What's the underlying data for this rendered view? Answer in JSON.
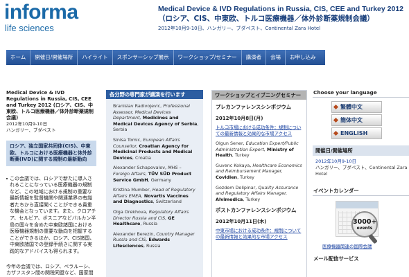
{
  "header": {
    "logo_main": "informa",
    "logo_sub": "life sciences",
    "title_en": "Medical Device & IVD Regulations in Russia, CIS, CEE and Turkey 2012",
    "title_jp": "（ロシア、CIS、中東欧、トルコ医療機器／体外診断薬規制会議）",
    "date_venue": "2012年10月9-10日、ハンガリー、ブダペスト、Continental Zara Hotel"
  },
  "nav": {
    "items": [
      "ホーム",
      "開催日/開催場所",
      "ハイライト",
      "スポンサーシップ展示",
      "ワークショップ/セミナー",
      "講演者",
      "会場",
      "お申し込み"
    ]
  },
  "left": {
    "title": "Medical Device & IVD Regulations in Russia, CIS, CEE and Turkey 2012 (ロシア、CIS、中東欧、トルコ医療機器／体外診断薬規制会議)",
    "date": "2012年10月9-10日",
    "place": "ハンガリー、ブダペスト",
    "highlight": "ロシア、独立国家共同体(CIS)、中東欧、トルコにおける医療機器と体外診断薬(IVD)に関する規制の最新動向",
    "para1": "この会議では、ロシアで新たに導入されることになっている医療機器の規制など、この地域における規制の重要な最新情報を監督機関や関連業界の有識者たちから直接聞くことができる貴重な機会となっています。また、クロアチア、セルビア、ボスニアなどバルカン半島の国々を含めた中東欧諸国における医療機器規制の重要な動向を把握することができるほか、ロシア、CIS諸国、中東欧諸国での登録手続きに関する実践的なアドバイスも得られます。",
    "para2": "今年の会議では、ロシア、ベラルーシ、カザフスタン間の関税同盟など、国家間の協調に向けた動きについての重"
  },
  "speakers": {
    "header": "各分野の専門家が講演を行います",
    "items": [
      {
        "name": "Branislav Radivojevic,",
        "role": "Professional Assessor, Medical Devices Department,",
        "org": "Medicines and Medical Devices Agency of Serbia",
        "country": ", Serbia"
      },
      {
        "name": "Sinisa Tomic,",
        "role": "European Affairs Counsellor,",
        "org": "Croatian Agency for Medicinal Products and Medical Devices",
        "country": ", Croatia"
      },
      {
        "name": "Alexander Schapovalov,",
        "role": "MHS – Foreign Affairs,",
        "org": "TÜV SÜD Product Service GmbH",
        "country": ", Germany"
      },
      {
        "name": "Kristina Mumber,",
        "role": "Head of Regulatory Affairs EMEA,",
        "org": "Novartis Vaccines and Diagnostics",
        "country": ", Switzerland"
      },
      {
        "name": "Olga Orekhova,",
        "role": "Regulatory Affairs Director Russia and CIS,",
        "org": "GE Healthcare",
        "country": ", Russia"
      },
      {
        "name": "Alexander Berezin,",
        "role": "Country Manager Russia and CIS,",
        "org": "Edwards Lifesciences",
        "country": ", Russia"
      }
    ]
  },
  "workshop": {
    "header": "ワークショップとイブニングセミナー",
    "pre_title": "プレカンファレンスシンポジウム",
    "pre_date": "2012年10月8日(月)",
    "pre_link": "トルコ市場における成功条件：規制についての最新情報と効果的な市場アクセス",
    "speakers": [
      {
        "name": "Olgun Sener,",
        "role": "Education Expert/Public Administration Expert,",
        "org": "Ministry of Health",
        "country": ", Turkey"
      },
      {
        "name": "Guvenc Kokaya,",
        "role": "Healthcare Economics and Reimbursement Manager,",
        "org": "Covidien",
        "country": ", Turkey"
      },
      {
        "name": "Gozdem Delipinar,",
        "role": "Quality Assurance and Regulatory Affairs Manager,",
        "org": "Alvimedica",
        "country": ", Turkey"
      }
    ],
    "post_title": "ポストカンファレンスシンポジウム",
    "post_date": "2012年10月11日(木)",
    "post_link": "中東市場における成功条件：規制についての最新情報と効果的な市場アクセス"
  },
  "right": {
    "lang_title": "Choose your language",
    "lang_buttons": [
      "繁體中文",
      "簡体中文",
      "ENGLISH"
    ],
    "event_title": "開催日/開催場所",
    "event_date": "2012年10月9-10日",
    "event_venue": "ハンガリー、ブダペスト、Continental Zara Hotel",
    "calendar_title": "イベントカレンダー",
    "calendar_badge_num": "3000+",
    "calendar_badge_text": "events",
    "calendar_link": "医療機器関連の国際会議",
    "mail_title": "メール配信サービス"
  },
  "colors": {
    "brand_blue": "#1b6aa8",
    "nav_blue": "#2c5da1",
    "title_navy": "#163d7a",
    "link_blue": "#1c44a2"
  }
}
